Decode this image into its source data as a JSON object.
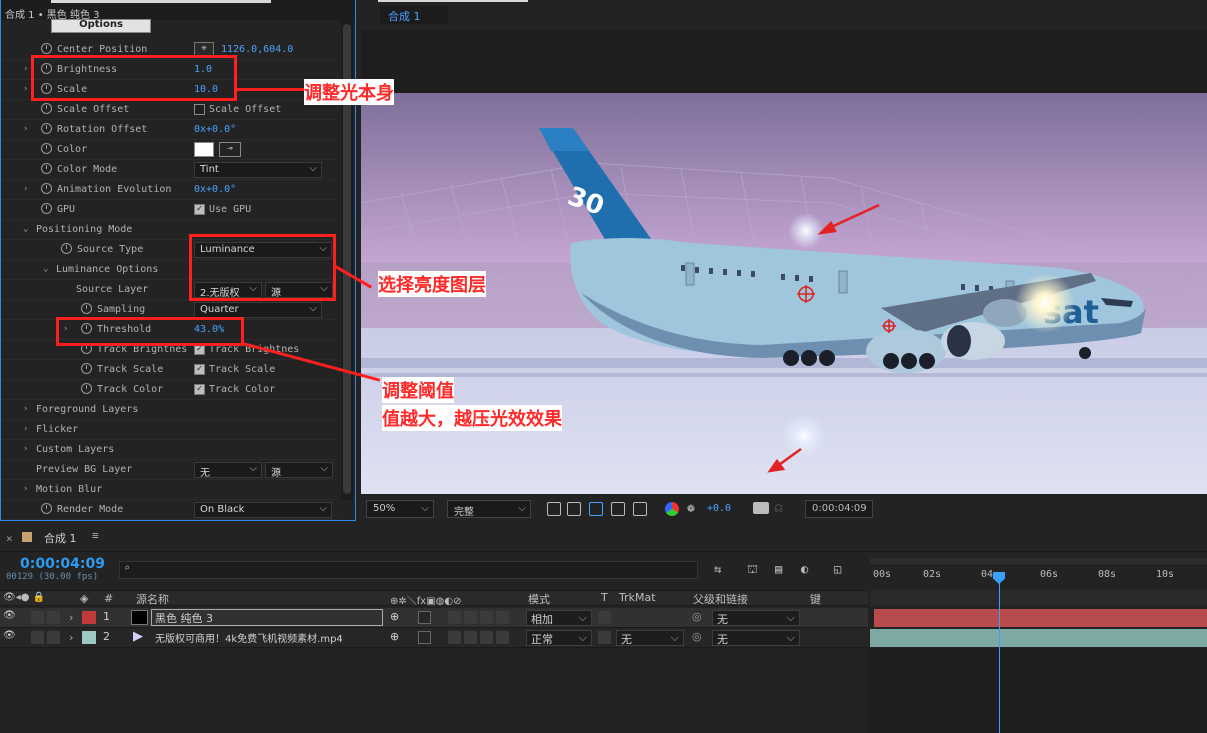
{
  "effect_panel": {
    "header": "合成 1 • 黑色 纯色 3",
    "options_label": "Options",
    "rows": [
      {
        "label": "Center Position",
        "value": "1126.0,604.0"
      },
      {
        "label": "Brightness",
        "value": "1.0"
      },
      {
        "label": "Scale",
        "value": "10.0"
      },
      {
        "label": "Scale Offset",
        "check_label": "Scale Offset"
      },
      {
        "label": "Rotation Offset",
        "value": "0x+0.0°"
      },
      {
        "label": "Color"
      },
      {
        "label": "Color Mode",
        "select": "Tint"
      },
      {
        "label": "Animation Evolution",
        "value": "0x+0.0°"
      },
      {
        "label": "GPU",
        "check_label": "Use GPU"
      },
      {
        "label": "Positioning Mode"
      },
      {
        "label": "Source Type",
        "select": "Luminance"
      },
      {
        "label": "Luminance Options"
      },
      {
        "label": "Source Layer",
        "select": "2.无版权",
        "select2": "源"
      },
      {
        "label": "Sampling",
        "select": "Quarter"
      },
      {
        "label": "Threshold",
        "value": "43.0%"
      },
      {
        "label": "Track Brightnes",
        "check_label": "Track Brightnes"
      },
      {
        "label": "Track Scale",
        "check_label": "Track Scale"
      },
      {
        "label": "Track Color",
        "check_label": "Track Color"
      },
      {
        "label": "Foreground Layers"
      },
      {
        "label": "Flicker"
      },
      {
        "label": "Custom Layers"
      },
      {
        "label": "Preview BG Layer",
        "select": "无",
        "select2": "源"
      },
      {
        "label": "Motion Blur"
      },
      {
        "label": "Render Mode",
        "select": "On Black"
      }
    ]
  },
  "viewer": {
    "tab": "合成 1",
    "zoom": "50%",
    "quality": "完整",
    "exposure": "+0.0",
    "timecode": "0:00:04:09",
    "video_text": "sat",
    "tail_number": "30"
  },
  "annotations": {
    "note1": "调整光本身",
    "note2": "选择亮度图层",
    "note3_line1": "调整阈值",
    "note3_line2": "值越大，越压光效效果"
  },
  "timeline": {
    "tab": "合成 1",
    "timecode": "0:00:04:09",
    "fps": "00129 (30.00 fps)",
    "search_placeholder": "",
    "columns": {
      "hash": "#",
      "source": "源名称",
      "mode": "模式",
      "t": "T",
      "trkmat": "TrkMat",
      "parent": "父级和链接",
      "key": "键"
    },
    "layers": [
      {
        "num": "1",
        "name": "黑色 纯色 3",
        "mode": "相加",
        "parent": "无",
        "label_color": "#c0393b"
      },
      {
        "num": "2",
        "name": "无版权可商用！4k免费飞机视频素材.mp4",
        "mode": "正常",
        "trkmat": "无",
        "parent": "无",
        "label_color": "#9dc8c4"
      }
    ],
    "ruler_ticks": [
      "00s",
      "02s",
      "04",
      "06s",
      "08s",
      "10s"
    ],
    "bar_colors": {
      "layer1": "#b84b4b",
      "layer2": "#7ea8a3"
    }
  }
}
